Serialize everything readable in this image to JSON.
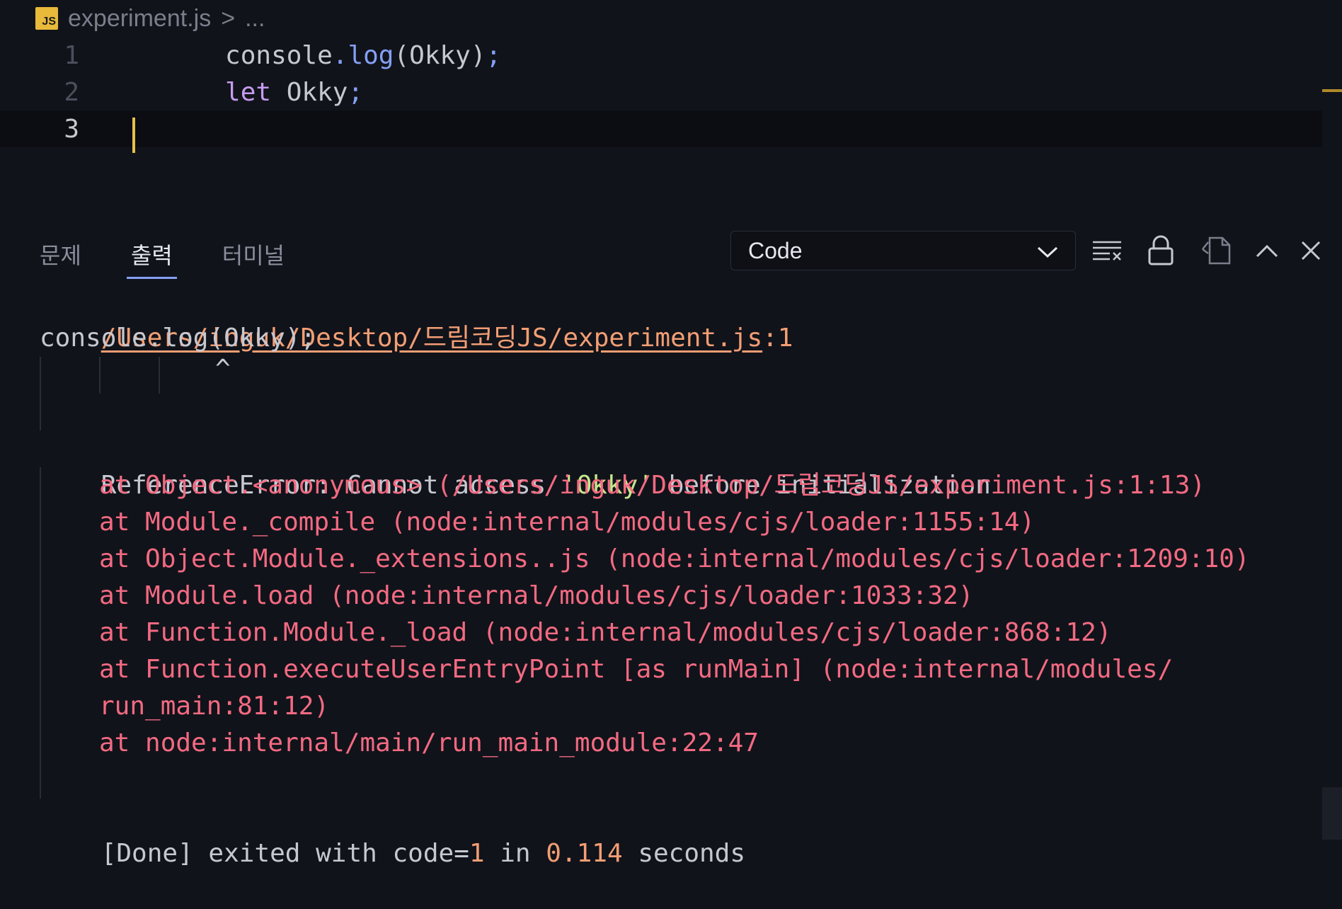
{
  "breadcrumb": {
    "icon": "JS",
    "file": "experiment.js",
    "separator": ">",
    "ellipsis": "..."
  },
  "editor": {
    "lines": [
      {
        "number": "1"
      },
      {
        "number": "2"
      },
      {
        "number": "3"
      }
    ],
    "line1": {
      "a": "console",
      "b": ".",
      "c": "log",
      "d": "(Okky)",
      "e": ";"
    },
    "line2": {
      "a": "let",
      "b": " Okky",
      "c": ";"
    }
  },
  "panel": {
    "tabs": [
      "문제",
      "출력",
      "터미널"
    ],
    "active_tab": "출력",
    "output_channel": "Code"
  },
  "output": {
    "file_link": "/Users/inguk/Desktop/드림코딩JS/experiment.js",
    "file_link_suffix": ":1",
    "source_line": "console.log(Okky);",
    "caret": "^",
    "error_prefix": "ReferenceError: Cannot access ",
    "error_name": "'Okky'",
    "error_suffix": " before initialization",
    "stack": [
      "at Object.<anonymous> (/Users/inguk/Desktop/드림코딩JS/experiment.js:1:13)",
      "at Module._compile (node:internal/modules/cjs/loader:1155:14)",
      "at Object.Module._extensions..js (node:internal/modules/cjs/loader:1209:10)",
      "at Module.load (node:internal/modules/cjs/loader:1033:32)",
      "at Function.Module._load (node:internal/modules/cjs/loader:868:12)",
      "at Function.executeUserEntryPoint [as runMain] (node:internal/modules/",
      "run_main:81:12)",
      "at node:internal/main/run_main_module:22:47"
    ],
    "done": {
      "prefix": "[Done] exited with code=",
      "code": "1",
      "mid": " in ",
      "seconds": "0.114",
      "suffix": " seconds"
    }
  },
  "colors": {
    "background": "#11131a",
    "error": "#f36a82",
    "link": "#f29e74",
    "string": "#c3e88d",
    "cursor": "#e6c04a"
  }
}
